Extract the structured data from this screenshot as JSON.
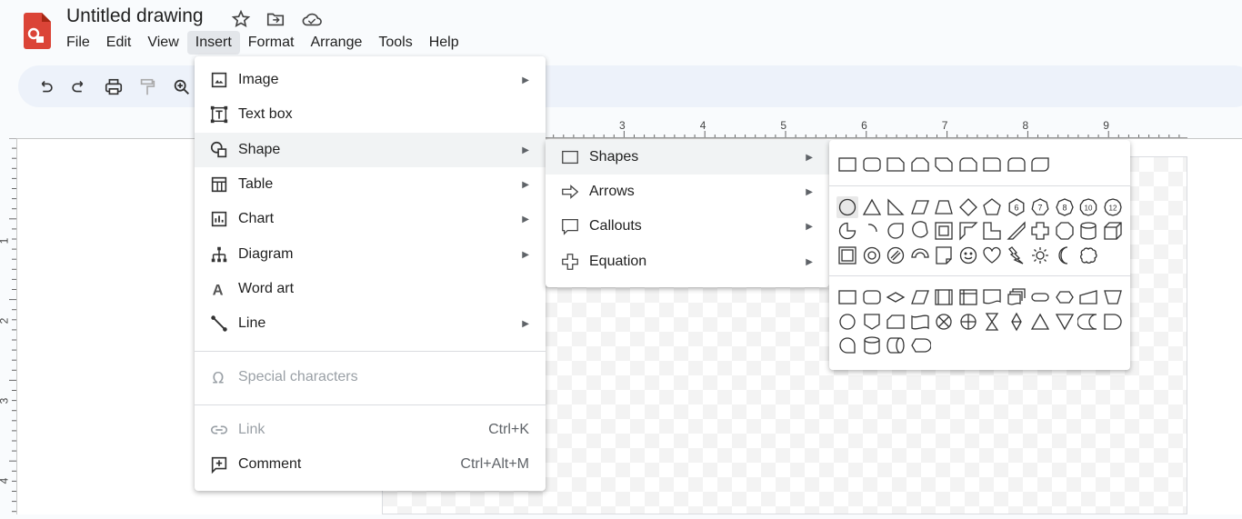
{
  "header": {
    "title": "Untitled drawing",
    "icons": [
      "star-icon",
      "move-to-folder-icon",
      "cloud-saved-icon"
    ]
  },
  "menubar": [
    "File",
    "Edit",
    "View",
    "Insert",
    "Format",
    "Arrange",
    "Tools",
    "Help"
  ],
  "toolbar": [
    "undo-icon",
    "redo-icon",
    "print-icon",
    "paint-format-icon",
    "zoom-icon"
  ],
  "rulers": {
    "horizontal": [
      "3",
      "4",
      "5",
      "6",
      "7",
      "8",
      "9"
    ],
    "vertical": [
      "1",
      "2",
      "3",
      "4"
    ]
  },
  "insert_menu": {
    "items": [
      {
        "label": "Image",
        "icon": "image-icon",
        "submenu": true
      },
      {
        "label": "Text box",
        "icon": "text-box-icon"
      },
      {
        "label": "Shape",
        "icon": "shape-icon",
        "submenu": true,
        "highlighted": true
      },
      {
        "label": "Table",
        "icon": "table-icon",
        "submenu": true
      },
      {
        "label": "Chart",
        "icon": "chart-icon",
        "submenu": true
      },
      {
        "label": "Diagram",
        "icon": "diagram-icon",
        "submenu": true
      },
      {
        "label": "Word art",
        "icon": "word-art-icon"
      },
      {
        "label": "Line",
        "icon": "line-icon",
        "submenu": true
      },
      {
        "label": "Special characters",
        "icon": "omega-icon",
        "disabled": true
      },
      {
        "label": "Link",
        "icon": "link-icon",
        "disabled": true,
        "shortcut": "Ctrl+K"
      },
      {
        "label": "Comment",
        "icon": "comment-icon",
        "shortcut": "Ctrl+Alt+M"
      }
    ]
  },
  "shape_menu": {
    "items": [
      {
        "label": "Shapes",
        "icon": "square-icon",
        "highlighted": true
      },
      {
        "label": "Arrows",
        "icon": "arrow-icon"
      },
      {
        "label": "Callouts",
        "icon": "callout-icon"
      },
      {
        "label": "Equation",
        "icon": "plus-icon"
      }
    ]
  },
  "shapes_palette": {
    "groups": [
      [
        [
          "rect",
          "round-rect",
          "snip1",
          "snip2",
          "snipdiag",
          "sniprnd",
          "roundsnip",
          "round2",
          "rounddiag"
        ]
      ],
      [
        [
          "ellipse",
          "triangle",
          "right-triangle",
          "parallelogram",
          "trapezoid",
          "diamond",
          "pentagon",
          "hexagon-6",
          "heptagon-7",
          "octagon-8",
          "decagon-10",
          "dodecagon-12"
        ],
        [
          "pie",
          "arc",
          "teardrop",
          "chord",
          "frame",
          "half-frame",
          "l-shape",
          "diagonal-stripe",
          "plus",
          "octagon-cross",
          "can",
          "cube"
        ],
        [
          "bevel",
          "donut",
          "no-symbol",
          "block-arc",
          "folded-corner",
          "smiley",
          "heart",
          "lightning",
          "sun",
          "moon",
          "cloud"
        ]
      ],
      [
        [
          "process",
          "alt-process",
          "decision",
          "data",
          "predefined",
          "internal-storage",
          "document",
          "multidocument",
          "terminator",
          "preparation",
          "manual-input",
          "manual-operation"
        ],
        [
          "connector",
          "offpage",
          "card",
          "punched-tape",
          "summing-junction",
          "or",
          "collate",
          "sort",
          "extract",
          "merge",
          "stored-data",
          "delay"
        ],
        [
          "sequential-storage",
          "magnetic-disk",
          "direct-access",
          "display"
        ]
      ]
    ]
  }
}
